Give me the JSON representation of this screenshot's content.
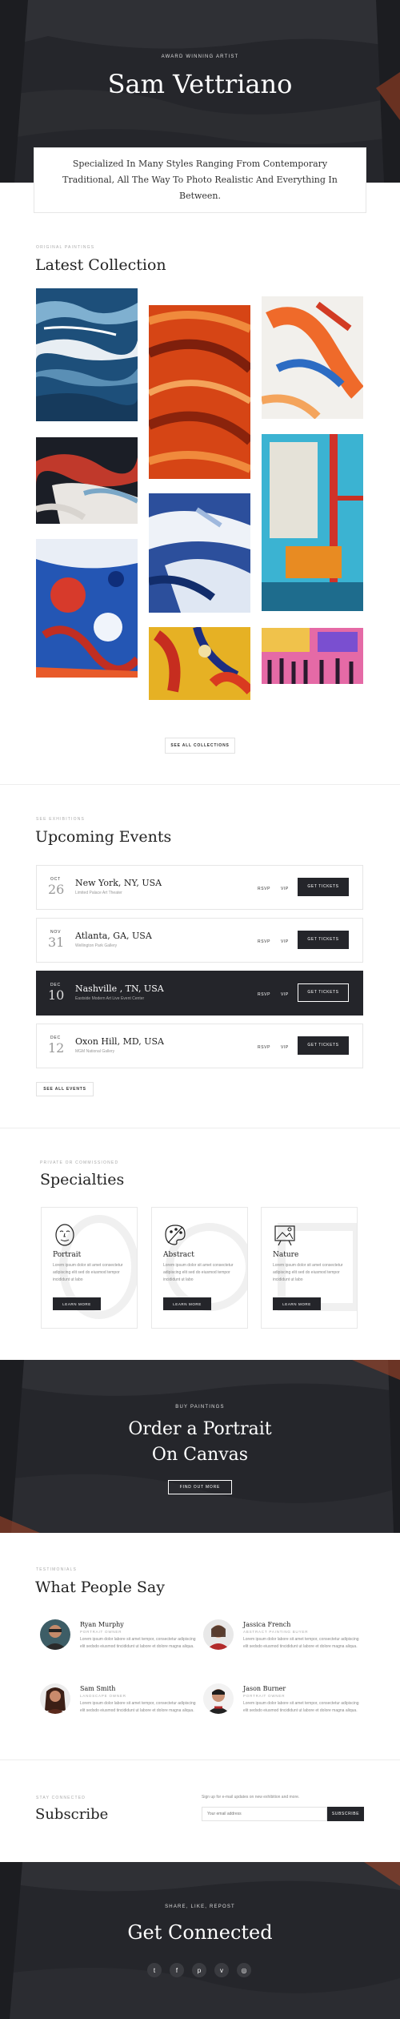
{
  "hero": {
    "eyebrow": "AWARD WINNING ARTIST",
    "title": "Sam Vettriano",
    "intro": "Specialized In Many Styles Ranging From Contemporary Traditional, All The Way To Photo Realistic And Everything In Between."
  },
  "collection": {
    "eyebrow": "ORIGINAL PAINTINGS",
    "title": "Latest Collection",
    "button": "SEE ALL COLLECTIONS"
  },
  "events": {
    "eyebrow": "SEE EXHIBITIONS",
    "title": "Upcoming Events",
    "items": [
      {
        "month": "OCT",
        "day": "26",
        "location": "New York, NY, USA",
        "venue": "Limited Palace Art Theater",
        "rsvp": "RSVP",
        "vip": "VIP",
        "tickets": "GET TICKETS"
      },
      {
        "month": "NOV",
        "day": "31",
        "location": "Atlanta, GA, USA",
        "venue": "Wellington Park Gallery",
        "rsvp": "RSVP",
        "vip": "VIP",
        "tickets": "GET TICKETS"
      },
      {
        "month": "DEC",
        "day": "10",
        "location": "Nashville , TN, USA",
        "venue": "Eastside Modern Art Live Event Center",
        "rsvp": "RSVP",
        "vip": "VIP",
        "tickets": "GET TICKETS"
      },
      {
        "month": "DEC",
        "day": "12",
        "location": "Oxon Hill, MD, USA",
        "venue": "MGM National Gallery",
        "rsvp": "RSVP",
        "vip": "VIP",
        "tickets": "GET TICKETS"
      }
    ],
    "button": "SEE ALL EVENTS"
  },
  "specialties": {
    "eyebrow": "PRIVATE OR COMMISSIONED",
    "title": "Specialties",
    "items": [
      {
        "name": "Portrait",
        "desc": "Lorem ipsum dolor sit amet consectetur adipiscing elit sed do eiusmod tempor incididunt ut labo",
        "button": "LEARN MORE",
        "icon": "face-icon"
      },
      {
        "name": "Abstract",
        "desc": "Lorem ipsum dolor sit amet consectetur adipiscing elit sed do eiusmod tempor incididunt ut labo",
        "button": "LEARN MORE",
        "icon": "palette-icon"
      },
      {
        "name": "Nature",
        "desc": "Lorem ipsum dolor sit amet consectetur adipiscing elit sed do eiusmod tempor incididunt ut labo",
        "button": "LEARN MORE",
        "icon": "landscape-icon"
      }
    ]
  },
  "cta": {
    "eyebrow": "BUY PAINTINGS",
    "line1": "Order a Portrait",
    "line2": "On Canvas",
    "button": "FIND OUT MORE"
  },
  "testimonials": {
    "eyebrow": "TESTIMONIALS",
    "title": "What People Say",
    "items": [
      {
        "name": "Ryan Murphy",
        "role": "PORTRAIT OWNER",
        "quote": "Lorem ipsum dolor labore sit amet tempor, consectetur adipiscing elit sedsdo eiusmod tincididunt ut labore et dolore magna aliqua."
      },
      {
        "name": "Jassica French",
        "role": "ABSTRACT PAINTING BUYER",
        "quote": "Lorem ipsum dolor labore sit amet tempor, consectetur adipiscing elit sedsdo eiusmod tincididunt ut labore et dolore magna aliqua."
      },
      {
        "name": "Sam Smith",
        "role": "LANDSCAPE OWNER",
        "quote": "Lorem ipsum dolor labore sit amet tempor, consectetur adipiscing elit sedsdo eiusmod tincididunt ut labore et dolore magna aliqua."
      },
      {
        "name": "Jason Burner",
        "role": "PORTRAIT OWNER",
        "quote": "Lorem ipsum dolor labore sit amet tempor, consectetur adipiscing elit sedsdo eiusmod tincididunt ut labore et dolore magna aliqua."
      }
    ]
  },
  "subscribe": {
    "eyebrow": "STAY CONNECTED",
    "title": "Subscribe",
    "note": "Sign up for e-mail updates on new exhibition and more.",
    "placeholder": "Your email address",
    "button": "SUBSCRIBE"
  },
  "footer": {
    "eyebrow": "SHARE, LIKE, REPOST",
    "title": "Get Connected",
    "social": [
      {
        "icon": "twitter-icon",
        "glyph": "t"
      },
      {
        "icon": "facebook-icon",
        "glyph": "f"
      },
      {
        "icon": "pinterest-icon",
        "glyph": "p"
      },
      {
        "icon": "vimeo-icon",
        "glyph": "v"
      },
      {
        "icon": "instagram-icon",
        "glyph": "◎"
      }
    ]
  },
  "colors": {
    "dark": "#24252a",
    "accent": "#c8502c",
    "muted": "#aaaaaa"
  }
}
